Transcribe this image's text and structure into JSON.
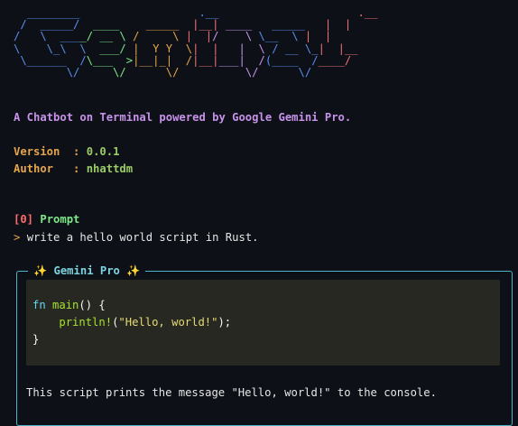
{
  "banner": {
    "lines": [
      [
        [
          "  ________",
          "#5b8def"
        ],
        [
          "                  .__           ",
          "#5b8def"
        ],
        [
          "          .__",
          "#f07178"
        ]
      ],
      [
        [
          " /  _____/",
          "#5b8def"
        ],
        [
          "  ____  ",
          "#7ee787"
        ],
        [
          "  _____",
          "#e5a54b"
        ],
        [
          "  |__|",
          "#f07178"
        ],
        [
          " ____  ",
          "#c792ea"
        ],
        [
          " _____ ",
          "#5b8def"
        ],
        [
          "  |  |",
          "#f07178"
        ]
      ],
      [
        [
          "/   \\  ___",
          "#5b8def"
        ],
        [
          "_/ __ \\ ",
          "#7ee787"
        ],
        [
          "/     \\ ",
          "#e5a54b"
        ],
        [
          "|  |",
          "#f07178"
        ],
        [
          "/    \\ ",
          "#c792ea"
        ],
        [
          "\\__  \\ ",
          "#5b8def"
        ],
        [
          "|  |",
          "#f07178"
        ]
      ],
      [
        [
          "\\    \\_\\  \\",
          "#5b8def"
        ],
        [
          "  ___/ ",
          "#7ee787"
        ],
        [
          "|  Y Y  \\",
          "#e5a54b"
        ],
        [
          "|  |",
          "#f07178"
        ],
        [
          "   |  \\ ",
          "#c792ea"
        ],
        [
          "/ __ \\_",
          "#5b8def"
        ],
        [
          "|  |__",
          "#f07178"
        ]
      ],
      [
        [
          " \\______  /",
          "#5b8def"
        ],
        [
          "\\___  >",
          "#7ee787"
        ],
        [
          "|__|_|  /",
          "#e5a54b"
        ],
        [
          "|__|",
          "#f07178"
        ],
        [
          "___|  /",
          "#c792ea"
        ],
        [
          "(____  /",
          "#5b8def"
        ],
        [
          "____/",
          "#f07178"
        ]
      ],
      [
        [
          "        \\/",
          "#5b8def"
        ],
        [
          "     \\/",
          "#7ee787"
        ],
        [
          "      \\/",
          "#e5a54b"
        ],
        [
          "          \\/",
          "#c792ea"
        ],
        [
          "      \\/",
          "#5b8def"
        ]
      ]
    ]
  },
  "tagline": "A Chatbot on Terminal powered by Google Gemini Pro.",
  "meta": {
    "version_label": "Version",
    "version_sep": "  : ",
    "version_value": "0.0.1",
    "author_label": "Author",
    "author_sep": "   : ",
    "author_value": "nhattdm"
  },
  "prompt": {
    "index": "[0]",
    "title": "Prompt",
    "caret": ">",
    "text": "write a hello world script in Rust."
  },
  "response": {
    "panel_title": "✨ Gemini Pro ✨",
    "code": {
      "l1_kw": "fn",
      "l1_name": "main",
      "l1_rest": "() {",
      "l2_indent": "    ",
      "l2_macro": "println!",
      "l2_open": "(",
      "l2_str": "\"Hello, world!\"",
      "l2_close": ");",
      "l3": "}"
    },
    "text": "This script prints the message \"Hello, world!\" to the console."
  }
}
